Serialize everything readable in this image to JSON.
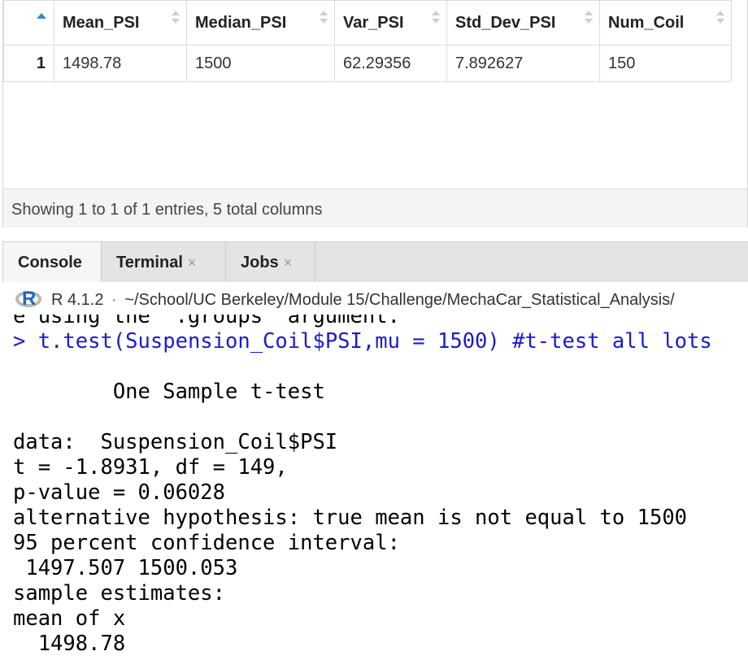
{
  "table": {
    "columns": [
      "Mean_PSI",
      "Median_PSI",
      "Var_PSI",
      "Std_Dev_PSI",
      "Num_Coil"
    ],
    "rows": [
      {
        "row_number": "1",
        "cells": [
          "1498.78",
          "1500",
          "62.29356",
          "7.892627",
          "150"
        ]
      }
    ],
    "status": "Showing 1 to 1 of 1 entries, 5 total columns"
  },
  "pane": {
    "tabs": [
      {
        "label": "Console",
        "closable": false
      },
      {
        "label": "Terminal",
        "closable": true
      },
      {
        "label": "Jobs",
        "closable": true
      }
    ],
    "close_glyph": "×",
    "r_version": "R 4.1.2",
    "separator": "·",
    "path": "~/School/UC Berkeley/Module 15/Challenge/MechaCar_Statistical_Analysis/",
    "logo_letter": "R"
  },
  "console": {
    "partial_line": "e using the `.groups` argument.",
    "prompt": "> ",
    "command": "t.test(Suspension_Coil$PSI,mu = 1500) #t-test all lots",
    "output": [
      "",
      "        One Sample t-test",
      "",
      "data:  Suspension_Coil$PSI",
      "t = -1.8931, df = 149,",
      "p-value = 0.06028",
      "alternative hypothesis: true mean is not equal to 1500",
      "95 percent confidence interval:",
      " 1497.507 1500.053",
      "sample estimates:",
      "mean of x",
      "  1498.78"
    ]
  },
  "colors": {
    "command": "#1a1ad6",
    "sort_active": "#3a87c8",
    "logo_blue": "#2368b8"
  },
  "icons": [
    "sort-ascending-icon",
    "sort-icon",
    "close-icon",
    "r-logo-icon"
  ]
}
